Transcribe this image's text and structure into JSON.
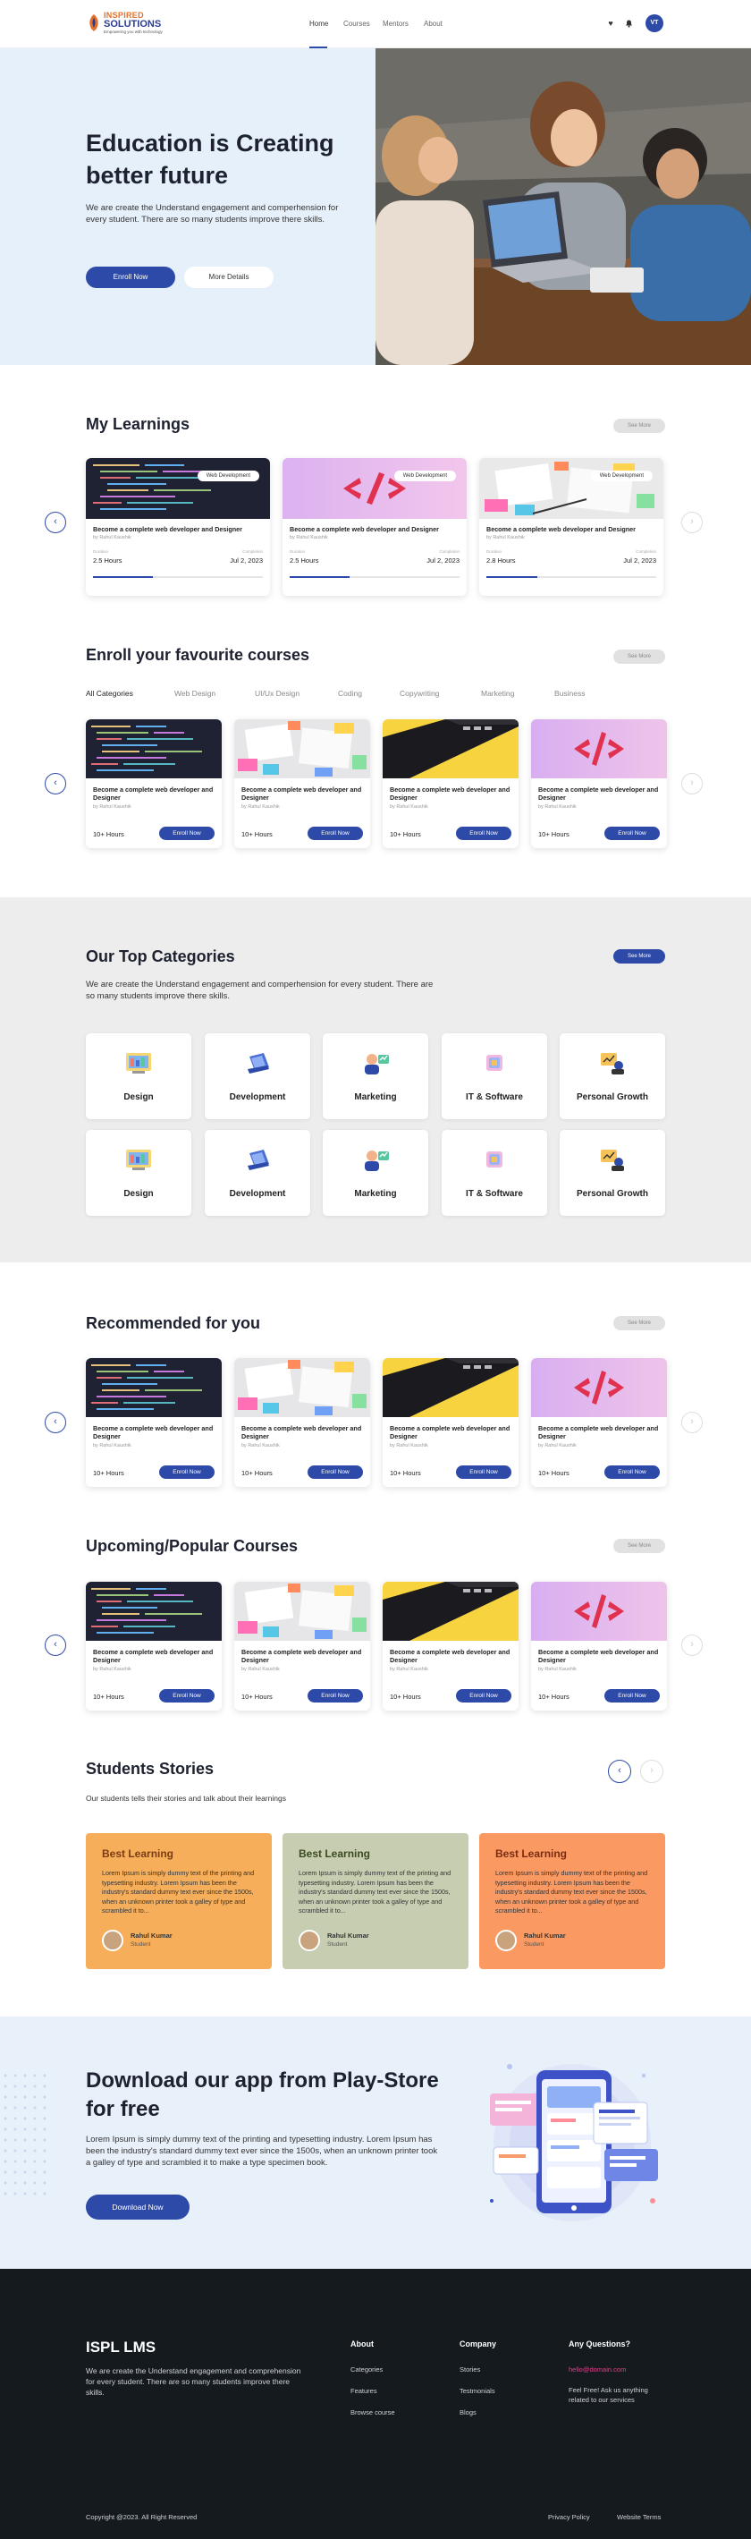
{
  "header": {
    "logo_line1": "INSPIRED",
    "logo_line2": "SOLUTIONS",
    "logo_tagline": "Empowering you with technology",
    "nav": [
      "Home",
      "Courses",
      "Mentors",
      "About"
    ],
    "avatar_initials": "VT"
  },
  "hero": {
    "title": "Education is Creating better future",
    "subtitle": "We are create the Understand engagement and comperhension for every student. There are so many students improve there skills.",
    "enroll_label": "Enroll Now",
    "details_label": "More Details"
  },
  "my_learnings": {
    "title": "My Learnings",
    "see_more": "See More",
    "cards": [
      {
        "tag": "Web Development",
        "title": "Become a complete web developer and Designer",
        "by": "by Rahul Kaushik",
        "duration_label": "Duration",
        "duration": "2.5 Hours",
        "completion_label": "Completion",
        "date": "Jul 2, 2023",
        "progress": 0.35
      },
      {
        "tag": "Web Development",
        "title": "Become a complete web developer and Designer",
        "by": "by Rahul Kaushik",
        "duration_label": "Duration",
        "duration": "2.5 Hours",
        "completion_label": "Completion",
        "date": "Jul 2, 2023",
        "progress": 0.35
      },
      {
        "tag": "Web Development",
        "title": "Become a complete web developer and Designer",
        "by": "by Rahul Kaushik",
        "duration_label": "Duration",
        "duration": "2.8 Hours",
        "completion_label": "Completion",
        "date": "Jul 2, 2023",
        "progress": 0.3
      }
    ]
  },
  "enroll_section": {
    "title": "Enroll your favourite courses",
    "see_more": "See More",
    "tabs": [
      "All Categories",
      "Web Design",
      "UI/Ux Design",
      "Coding",
      "Copywriting",
      "Marketing",
      "Business"
    ]
  },
  "course_card": {
    "title": "Become a complete web developer and Designer",
    "by": "by Rahul Kaushik",
    "hours": "10+ Hours",
    "enroll_label": "Enroll Now"
  },
  "categories": {
    "title": "Our Top Categories",
    "see_more": "See More",
    "subtitle": "We are create the Understand engagement and comperhension for every student. There are so many students improve there skills.",
    "items": [
      "Design",
      "Development",
      "Marketing",
      "IT & Software",
      "Personal Growth",
      "Design",
      "Development",
      "Marketing",
      "IT & Software",
      "Personal Growth"
    ]
  },
  "recommended": {
    "title": "Recommended for you",
    "see_more": "See More"
  },
  "upcoming": {
    "title": "Upcoming/Popular Courses",
    "see_more": "See More"
  },
  "stories": {
    "title": "Students Stories",
    "subtitle": "Our students tells their stories and talk about their learnings",
    "items": [
      {
        "title": "Best Learning",
        "body": "Lorem Ipsum is simply dummy text of the printing and typesetting industry. Lorem Ipsum has been the industry's standard dummy text ever since the 1500s, when an unknown printer took a galley of type and scrambled it to...",
        "name": "Rahul Kumar",
        "role": "Student",
        "color": "#f6ae5a",
        "title_color": "#7a3c12"
      },
      {
        "title": "Best Learning",
        "body": "Lorem Ipsum is simply dummy text of the printing and typesetting industry. Lorem Ipsum has been the industry's standard dummy text ever since the 1500s, when an unknown printer took a galley of type and scrambled it to...",
        "name": "Rahul Kumar",
        "role": "Student",
        "color": "#c6cdb1",
        "title_color": "#3c4a20"
      },
      {
        "title": "Best Learning",
        "body": "Lorem Ipsum is simply dummy text of the printing and typesetting industry. Lorem Ipsum has been the industry's standard dummy text ever since the 1500s, when an unknown printer took a galley of type and scrambled it to...",
        "name": "Rahul Kumar",
        "role": "Student",
        "color": "#fa9a62",
        "title_color": "#7a2c10"
      }
    ]
  },
  "app": {
    "title": "Download our app from Play-Store for free",
    "subtitle": "Lorem Ipsum is simply dummy text of the printing and typesetting industry. Lorem Ipsum has been the industry's standard dummy text ever since the 1500s, when an unknown printer took a galley of type and scrambled it to make a type specimen book.",
    "button": "Download Now"
  },
  "footer": {
    "brand": "ISPL LMS",
    "description": "We are create the Understand engagement and comprehension for every student. There are so many students improve there skills.",
    "about_title": "About",
    "about_links": [
      "Categories",
      "Features",
      "Browse course"
    ],
    "company_title": "Company",
    "company_links": [
      "Stories",
      "Testmonials",
      "Blogs"
    ],
    "questions_title": "Any Questions?",
    "email": "hello@domain.com",
    "questions_text": "Feel Free! Ask us anything related to our services",
    "copyright": "Copyright @2023. All Right Reserved",
    "privacy": "Privacy Policy",
    "terms": "Website Terms"
  },
  "colors": {
    "primary": "#2d4aa8",
    "hero_bg": "#e6f0fb",
    "footer_bg": "#151a1f",
    "email": "#e0408a"
  }
}
